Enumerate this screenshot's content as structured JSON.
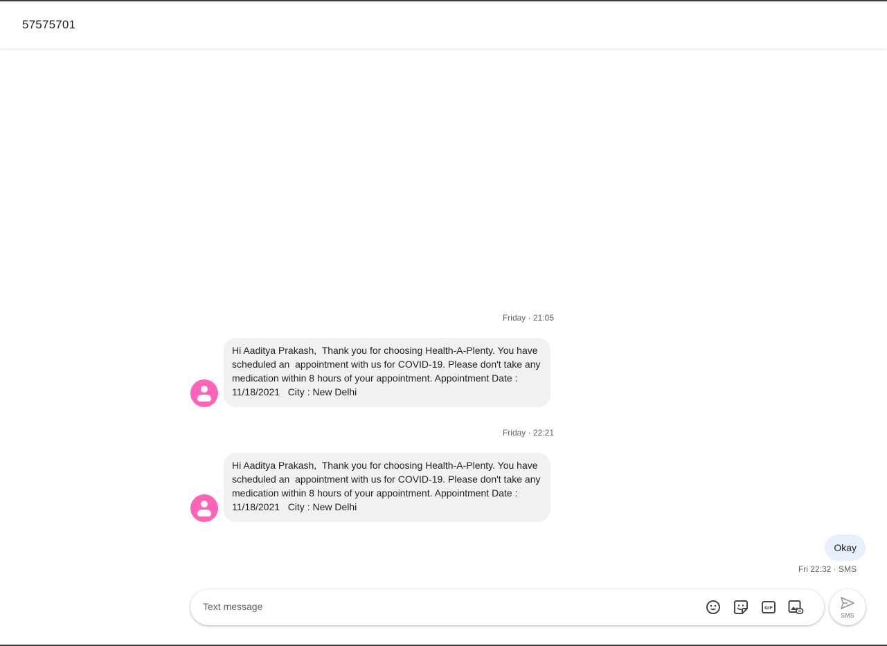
{
  "header": {
    "title": "57575701"
  },
  "conversation": {
    "messages": [
      {
        "timestamp": "Friday · 21:05",
        "text": "Hi Aaditya Prakash,  Thank you for choosing Health-A-Plenty. You have scheduled an  appointment with us for COVID-19. Please don't take any medication within 8 hours of your appointment. Appointment Date : 11/18/2021   City : New Delhi"
      },
      {
        "timestamp": "Friday · 22:21",
        "text": "Hi Aaditya Prakash,  Thank you for choosing Health-A-Plenty. You have scheduled an  appointment with us for COVID-19. Please don't take any medication within 8 hours of your appointment. Appointment Date : 11/18/2021   City : New Delhi"
      }
    ],
    "outgoing": {
      "text": "Okay",
      "meta": "Fri 22:32 · SMS"
    }
  },
  "composer": {
    "placeholder": "Text message",
    "value": "",
    "icons": [
      "emoji-icon",
      "sticker-icon",
      "gif-icon",
      "media-icon"
    ],
    "send_label": "SMS"
  },
  "colors": {
    "avatar": "#ff63b8",
    "incoming_bubble": "#f1f1f1",
    "outgoing_bubble": "#e8f0fe"
  }
}
